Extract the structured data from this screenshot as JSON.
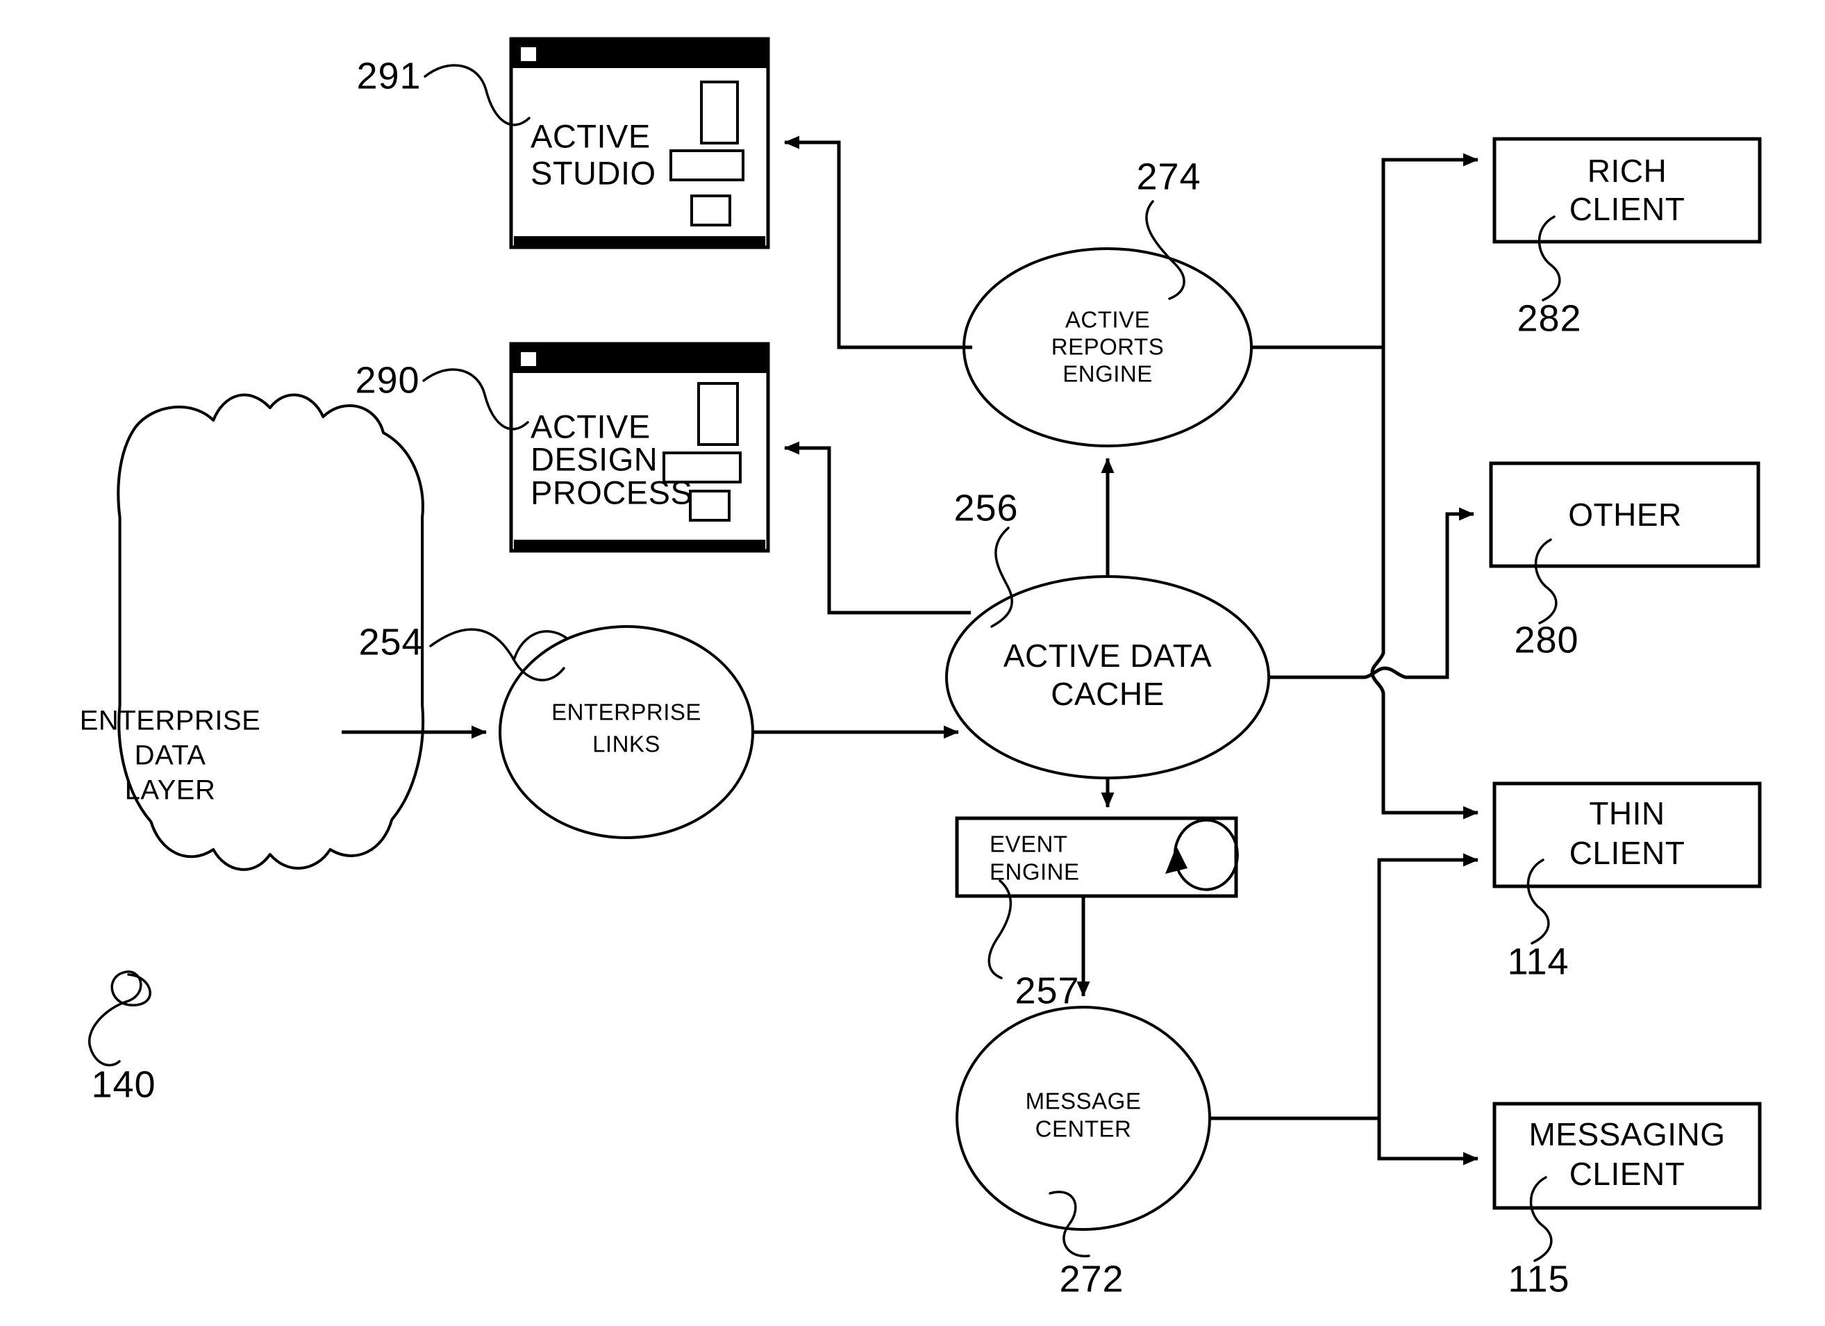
{
  "figure": {
    "type": "patent-block-diagram",
    "title": "Active data architecture block diagram"
  },
  "nodes": {
    "enterprise_data_layer": {
      "label_lines": [
        "ENTERPRISE",
        "DATA",
        "LAYER"
      ],
      "ref": "140",
      "shape": "cloud"
    },
    "enterprise_links": {
      "label_lines": [
        "ENTERPRISE",
        "LINKS"
      ],
      "ref": "254",
      "shape": "ellipse"
    },
    "active_data_cache": {
      "label_lines": [
        "ACTIVE DATA",
        "CACHE"
      ],
      "ref": "256",
      "shape": "ellipse"
    },
    "active_reports_engine": {
      "label_lines": [
        "ACTIVE",
        "REPORTS",
        "ENGINE"
      ],
      "ref": "274",
      "shape": "ellipse"
    },
    "event_engine": {
      "label_lines": [
        "EVENT",
        "ENGINE"
      ],
      "ref": "257",
      "shape": "rectangle",
      "icon": "circular-loop-arrow"
    },
    "message_center": {
      "label_lines": [
        "MESSAGE",
        "CENTER"
      ],
      "ref": "272",
      "shape": "ellipse"
    },
    "active_studio": {
      "label_lines": [
        "ACTIVE",
        "STUDIO"
      ],
      "ref": "291",
      "shape": "window"
    },
    "active_design_process": {
      "label_lines": [
        "ACTIVE",
        "DESIGN",
        "PROCESS"
      ],
      "ref": "290",
      "shape": "window"
    },
    "rich_client": {
      "label_lines": [
        "RICH",
        "CLIENT"
      ],
      "ref": "282",
      "shape": "rectangle"
    },
    "other": {
      "label_lines": [
        "OTHER"
      ],
      "ref": "280",
      "shape": "rectangle"
    },
    "thin_client": {
      "label_lines": [
        "THIN",
        "CLIENT"
      ],
      "ref": "114",
      "shape": "rectangle"
    },
    "messaging_client": {
      "label_lines": [
        "MESSAGING",
        "CLIENT"
      ],
      "ref": "115",
      "shape": "rectangle"
    }
  },
  "connections": [
    {
      "from": "enterprise_data_layer",
      "to": "enterprise_links",
      "arrow": "single"
    },
    {
      "from": "enterprise_links",
      "to": "active_data_cache",
      "arrow": "single"
    },
    {
      "from": "active_data_cache",
      "to": "active_reports_engine",
      "arrow": "single"
    },
    {
      "from": "active_data_cache",
      "to": "active_design_process",
      "arrow": "single"
    },
    {
      "from": "active_reports_engine",
      "to": "active_studio",
      "arrow": "single"
    },
    {
      "from": "active_reports_engine",
      "to": "rich_client",
      "arrow": "single"
    },
    {
      "from": "active_reports_engine",
      "to": "thin_client",
      "arrow": "single"
    },
    {
      "from": "active_data_cache",
      "to": "other",
      "arrow": "single"
    },
    {
      "from": "active_data_cache",
      "to": "event_engine",
      "arrow": "single"
    },
    {
      "from": "event_engine",
      "to": "message_center",
      "arrow": "single"
    },
    {
      "from": "message_center",
      "to": "thin_client",
      "arrow": "single"
    },
    {
      "from": "message_center",
      "to": "messaging_client",
      "arrow": "single"
    }
  ],
  "colors": {
    "stroke": "#000000",
    "background": "#ffffff",
    "titlebar": "#000000"
  }
}
